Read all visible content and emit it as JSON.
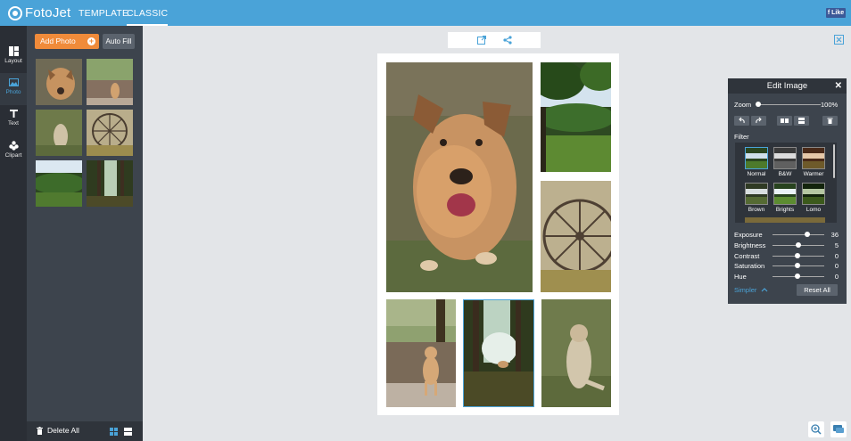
{
  "app": {
    "name": "FotoJet"
  },
  "nav": {
    "template": "TEMPLATE",
    "classic": "CLASSIC"
  },
  "fb": {
    "like": "f Like"
  },
  "rail": [
    {
      "label": "Layout",
      "icon": "layout-icon"
    },
    {
      "label": "Photo",
      "icon": "photo-icon"
    },
    {
      "label": "Text",
      "icon": "text-icon"
    },
    {
      "label": "Clipart",
      "icon": "clipart-icon"
    }
  ],
  "panel": {
    "add_photo": "Add Photo",
    "auto_fill": "Auto Fill",
    "delete_all": "Delete All"
  },
  "edit": {
    "title": "Edit Image",
    "zoom_label": "Zoom",
    "zoom_value": "100%",
    "filter_label": "Filter",
    "filters": [
      "Normal",
      "B&W",
      "Warmer",
      "Brown",
      "Brights",
      "Lomo"
    ],
    "adjust": [
      {
        "label": "Exposure",
        "value": "36"
      },
      {
        "label": "Brightness",
        "value": "5"
      },
      {
        "label": "Contrast",
        "value": "0"
      },
      {
        "label": "Saturation",
        "value": "0"
      },
      {
        "label": "Hue",
        "value": "0"
      }
    ],
    "simpler": "Simpler",
    "reset_all": "Reset All"
  },
  "colors": {
    "accent": "#4aa3d8",
    "add_button": "#f08b3a",
    "panel": "#3d444d",
    "rail": "#2a2e35"
  }
}
